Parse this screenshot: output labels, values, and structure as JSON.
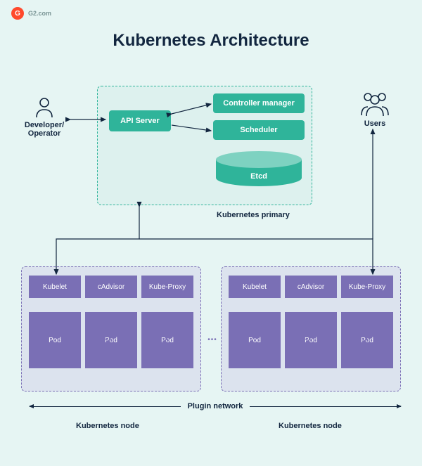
{
  "brand": {
    "logo_letter": "G",
    "name": "G2.com"
  },
  "title": "Kubernetes Architecture",
  "actors": {
    "developer": "Developer/\nOperator",
    "users": "Users"
  },
  "primary": {
    "api_server": "API Server",
    "controller_manager": "Controller manager",
    "scheduler": "Scheduler",
    "etcd": "Etcd",
    "label": "Kubernetes primary"
  },
  "node": {
    "kubelet": "Kubelet",
    "cadvisor": "cAdvisor",
    "kubeproxy": "Kube-Proxy",
    "pod": "Pod",
    "label_left": "Kubernetes node",
    "label_right": "Kubernetes node"
  },
  "plugin_network": "Plugin network"
}
